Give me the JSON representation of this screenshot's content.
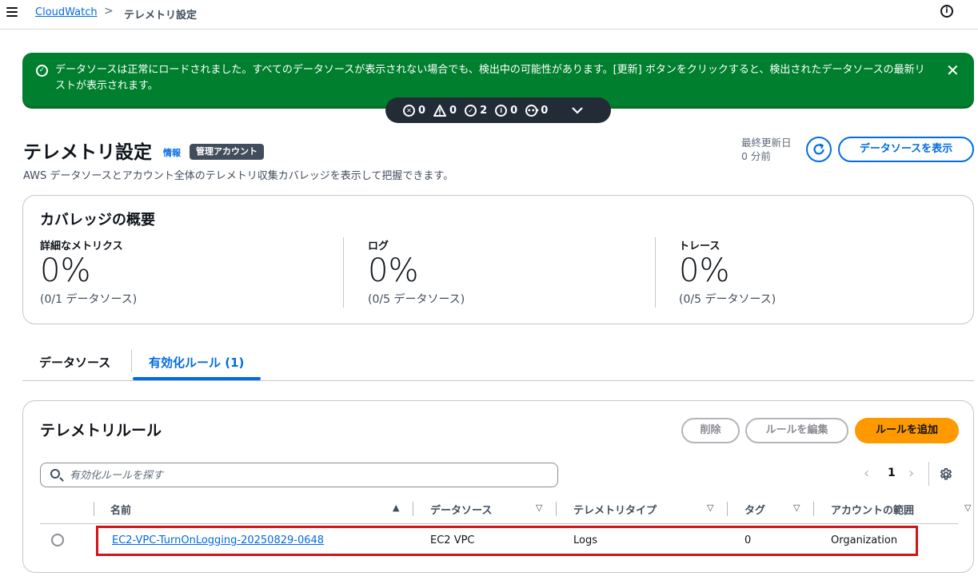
{
  "breadcrumb": {
    "root": "CloudWatch",
    "separator": ">",
    "current": "テレメトリ設定"
  },
  "flash": {
    "message": "データソースは正常にロードされました。すべてのデータソースが表示されない場合でも、検出中の可能性があります。[更新] ボタンをクリックすると、検出されたデータソースの最新リストが表示されます。",
    "close": "✕"
  },
  "notifications": {
    "error": "0",
    "warning": "0",
    "success": "2",
    "info": "0",
    "in_progress": "0"
  },
  "header": {
    "title": "テレメトリ設定",
    "info": "情報",
    "badge": "管理アカウント",
    "description": "AWS データソースとアカウント全体のテレメトリ収集カバレッジを表示して把握できます。",
    "last_updated_label": "最終更新日",
    "last_updated_value": "0 分前",
    "show_datasources": "データソースを表示"
  },
  "coverage": {
    "title": "カバレッジの概要",
    "metrics": [
      {
        "label": "詳細なメトリクス",
        "value": "0%",
        "sub": "(0/1 データソース)"
      },
      {
        "label": "ログ",
        "value": "0%",
        "sub": "(0/5 データソース)"
      },
      {
        "label": "トレース",
        "value": "0%",
        "sub": "(0/5 データソース)"
      }
    ]
  },
  "tabs": [
    {
      "label": "データソース"
    },
    {
      "label": "有効化ルール (1)"
    }
  ],
  "rules": {
    "title": "テレメトリルール",
    "delete": "削除",
    "edit": "ルールを編集",
    "add": "ルールを追加",
    "search_placeholder": "有効化ルールを探す",
    "page": "1",
    "columns": [
      "名前",
      "データソース",
      "テレメトリタイプ",
      "タグ",
      "アカウントの範囲"
    ],
    "rows": [
      {
        "name": "EC2-VPC-TurnOnLogging-20250829-0648",
        "datasource": "EC2 VPC",
        "type": "Logs",
        "tags": "0",
        "scope": "Organization"
      }
    ]
  }
}
